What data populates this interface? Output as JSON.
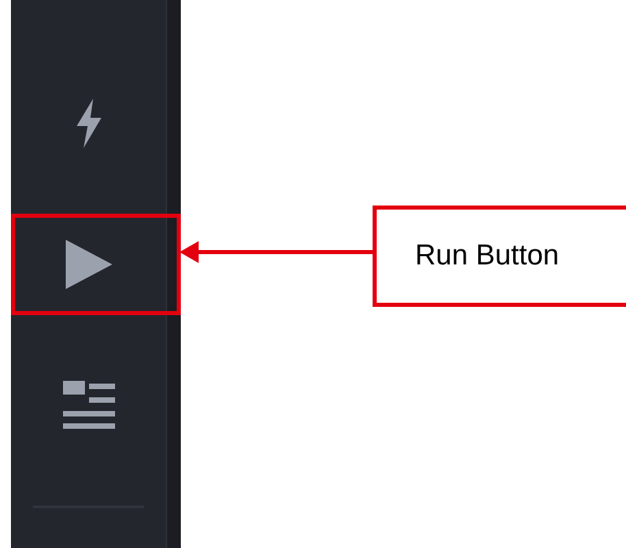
{
  "sidebar": {
    "items": [
      {
        "kind": "lightning",
        "highlighted": false
      },
      {
        "kind": "play",
        "highlighted": true
      },
      {
        "kind": "list",
        "highlighted": false
      }
    ]
  },
  "callout": {
    "text": "Run Button"
  }
}
